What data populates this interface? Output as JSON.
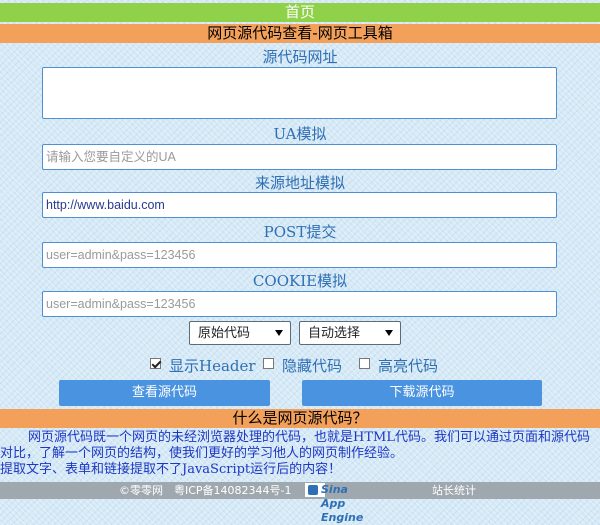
{
  "nav": {
    "home": "首页"
  },
  "header": {
    "title": "网页源代码查看-网页工具箱"
  },
  "form": {
    "url_label": "源代码网址",
    "url_value": "",
    "ua_label": "UA模拟",
    "ua_placeholder": "请输入您要自定义的UA",
    "referer_label": "来源地址模拟",
    "referer_value": "http://www.baidu.com",
    "post_label": "POST提交",
    "post_placeholder": "user=admin&pass=123456",
    "cookie_label": "COOKIE模拟",
    "cookie_placeholder": "user=admin&pass=123456",
    "mode_select": "原始代码",
    "charset_select": "自动选择",
    "options": [
      {
        "label": "显示Header",
        "checked": true
      },
      {
        "label": "隐藏代码",
        "checked": false
      },
      {
        "label": "高亮代码",
        "checked": false
      }
    ],
    "view_button": "查看源代码",
    "download_button": "下载源代码"
  },
  "about": {
    "title": "什么是网页源代码？",
    "para1": "网页源代码既一个网页的未经浏览器处理的代码，也就是HTML代码。我们可以通过页面和源代码对比，了解一个网页的结构，使我们更好的学习他人的网页制作经验。",
    "para2": "提取文字、表单和链接提取不了JavaScript运行后的内容！"
  },
  "footer": {
    "copyright": "©零零网",
    "icp": "粤ICP备14082344号-1",
    "engine_badge": "Sina App Engine",
    "stats": "站长统计"
  }
}
